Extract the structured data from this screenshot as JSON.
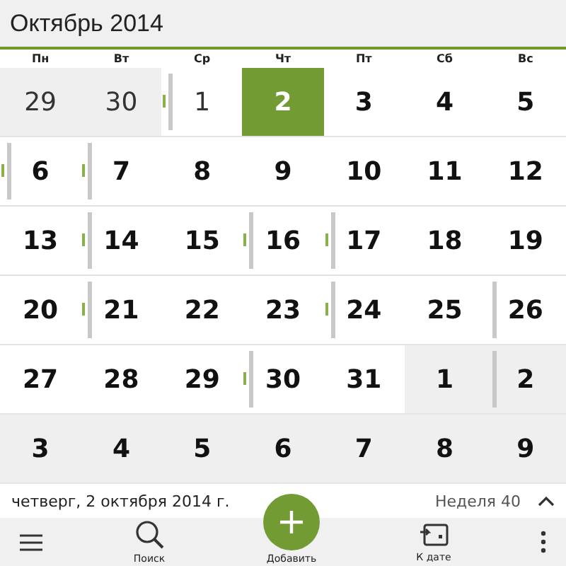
{
  "header": {
    "title": "Октябрь 2014"
  },
  "weekdays": [
    "Пн",
    "Вт",
    "Ср",
    "Чт",
    "Пт",
    "Сб",
    "Вс"
  ],
  "weeks": [
    [
      {
        "day": "29",
        "in_month": false,
        "past": true,
        "selected": false,
        "event": false,
        "tick": false
      },
      {
        "day": "30",
        "in_month": false,
        "past": true,
        "selected": false,
        "event": false,
        "tick": false
      },
      {
        "day": "1",
        "in_month": true,
        "past": true,
        "selected": false,
        "event": true,
        "tick": true
      },
      {
        "day": "2",
        "in_month": true,
        "past": false,
        "selected": true,
        "event": false,
        "tick": false
      },
      {
        "day": "3",
        "in_month": true,
        "past": false,
        "selected": false,
        "event": false,
        "tick": false
      },
      {
        "day": "4",
        "in_month": true,
        "past": false,
        "selected": false,
        "event": false,
        "tick": false
      },
      {
        "day": "5",
        "in_month": true,
        "past": false,
        "selected": false,
        "event": false,
        "tick": false
      }
    ],
    [
      {
        "day": "6",
        "in_month": true,
        "past": false,
        "selected": false,
        "event": true,
        "tick": true
      },
      {
        "day": "7",
        "in_month": true,
        "past": false,
        "selected": false,
        "event": true,
        "tick": true
      },
      {
        "day": "8",
        "in_month": true,
        "past": false,
        "selected": false,
        "event": false,
        "tick": false
      },
      {
        "day": "9",
        "in_month": true,
        "past": false,
        "selected": false,
        "event": false,
        "tick": false
      },
      {
        "day": "10",
        "in_month": true,
        "past": false,
        "selected": false,
        "event": false,
        "tick": false
      },
      {
        "day": "11",
        "in_month": true,
        "past": false,
        "selected": false,
        "event": false,
        "tick": false
      },
      {
        "day": "12",
        "in_month": true,
        "past": false,
        "selected": false,
        "event": false,
        "tick": false
      }
    ],
    [
      {
        "day": "13",
        "in_month": true,
        "past": false,
        "selected": false,
        "event": false,
        "tick": false
      },
      {
        "day": "14",
        "in_month": true,
        "past": false,
        "selected": false,
        "event": true,
        "tick": true
      },
      {
        "day": "15",
        "in_month": true,
        "past": false,
        "selected": false,
        "event": false,
        "tick": false
      },
      {
        "day": "16",
        "in_month": true,
        "past": false,
        "selected": false,
        "event": true,
        "tick": true
      },
      {
        "day": "17",
        "in_month": true,
        "past": false,
        "selected": false,
        "event": true,
        "tick": true
      },
      {
        "day": "18",
        "in_month": true,
        "past": false,
        "selected": false,
        "event": false,
        "tick": false
      },
      {
        "day": "19",
        "in_month": true,
        "past": false,
        "selected": false,
        "event": false,
        "tick": false
      }
    ],
    [
      {
        "day": "20",
        "in_month": true,
        "past": false,
        "selected": false,
        "event": false,
        "tick": false
      },
      {
        "day": "21",
        "in_month": true,
        "past": false,
        "selected": false,
        "event": true,
        "tick": true
      },
      {
        "day": "22",
        "in_month": true,
        "past": false,
        "selected": false,
        "event": false,
        "tick": false
      },
      {
        "day": "23",
        "in_month": true,
        "past": false,
        "selected": false,
        "event": false,
        "tick": false
      },
      {
        "day": "24",
        "in_month": true,
        "past": false,
        "selected": false,
        "event": true,
        "tick": true
      },
      {
        "day": "25",
        "in_month": true,
        "past": false,
        "selected": false,
        "event": false,
        "tick": false
      },
      {
        "day": "26",
        "in_month": true,
        "past": false,
        "selected": false,
        "event": true,
        "tick": false
      }
    ],
    [
      {
        "day": "27",
        "in_month": true,
        "past": false,
        "selected": false,
        "event": false,
        "tick": false
      },
      {
        "day": "28",
        "in_month": true,
        "past": false,
        "selected": false,
        "event": false,
        "tick": false
      },
      {
        "day": "29",
        "in_month": true,
        "past": false,
        "selected": false,
        "event": false,
        "tick": false
      },
      {
        "day": "30",
        "in_month": true,
        "past": false,
        "selected": false,
        "event": true,
        "tick": true
      },
      {
        "day": "31",
        "in_month": true,
        "past": false,
        "selected": false,
        "event": false,
        "tick": false
      },
      {
        "day": "1",
        "in_month": false,
        "past": false,
        "selected": false,
        "event": false,
        "tick": false
      },
      {
        "day": "2",
        "in_month": false,
        "past": false,
        "selected": false,
        "event": true,
        "tick": false
      }
    ],
    [
      {
        "day": "3",
        "in_month": false,
        "past": false,
        "selected": false,
        "event": false,
        "tick": false
      },
      {
        "day": "4",
        "in_month": false,
        "past": false,
        "selected": false,
        "event": false,
        "tick": false
      },
      {
        "day": "5",
        "in_month": false,
        "past": false,
        "selected": false,
        "event": false,
        "tick": false
      },
      {
        "day": "6",
        "in_month": false,
        "past": false,
        "selected": false,
        "event": false,
        "tick": false
      },
      {
        "day": "7",
        "in_month": false,
        "past": false,
        "selected": false,
        "event": false,
        "tick": false
      },
      {
        "day": "8",
        "in_month": false,
        "past": false,
        "selected": false,
        "event": false,
        "tick": false
      },
      {
        "day": "9",
        "in_month": false,
        "past": false,
        "selected": false,
        "event": false,
        "tick": false
      }
    ]
  ],
  "status": {
    "date": "четверг, 2 октября 2014 г.",
    "week": "Неделя 40",
    "expanded": false
  },
  "toolbar": [
    {
      "kind": "menu"
    },
    {
      "kind": "search",
      "label": "Поиск"
    },
    {
      "kind": "add",
      "label": "Добавить"
    },
    {
      "kind": "goto",
      "label": "К дате"
    },
    {
      "kind": "more"
    }
  ]
}
